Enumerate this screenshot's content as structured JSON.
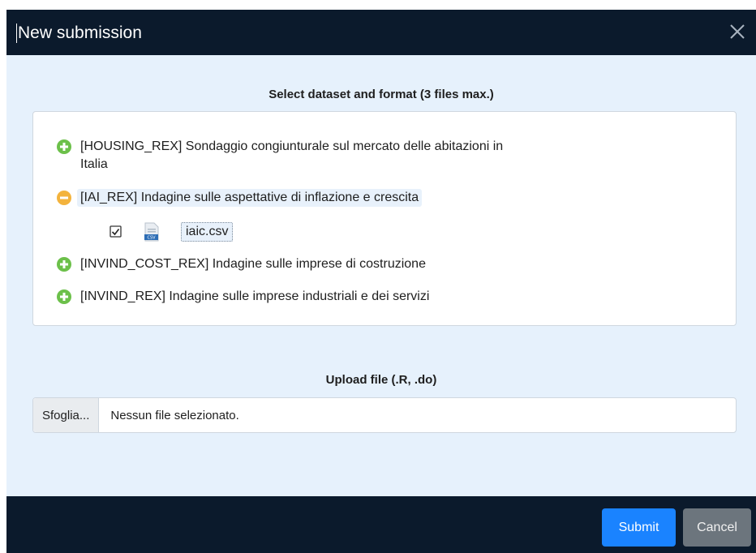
{
  "modal": {
    "title": "New submission",
    "close_icon": "close-icon"
  },
  "datasets": {
    "title": "Select dataset and format (3 files max.)",
    "items": [
      {
        "code_label": "[HOUSING_REX] Sondaggio congiunturale sul mercato delle abitazioni in",
        "label_line2": "Italia",
        "state": "collapsed",
        "icon": "plus-circle-icon"
      },
      {
        "code_label": "[IAI_REX] Indagine sulle aspettative di inflazione e crescita",
        "state": "expanded",
        "icon": "minus-circle-icon",
        "files": [
          {
            "name": "iaic.csv",
            "checked": true,
            "icon": "csv-file-icon"
          }
        ]
      },
      {
        "code_label": "[INVIND_COST_REX] Indagine sulle imprese di costruzione",
        "state": "collapsed",
        "icon": "plus-circle-icon"
      },
      {
        "code_label": "[INVIND_REX] Indagine sulle imprese industriali e dei servizi",
        "state": "collapsed",
        "icon": "plus-circle-icon"
      }
    ]
  },
  "upload": {
    "title": "Upload file (.R, .do)",
    "browse_label": "Sfoglia...",
    "status_text": "Nessun file selezionato."
  },
  "footer": {
    "submit_label": "Submit",
    "cancel_label": "Cancel"
  },
  "colors": {
    "header_bg": "#0b1a2c",
    "body_bg": "#e6f1fc",
    "plus_green": "#6cc04a",
    "minus_yellow": "#f3b33d",
    "submit_blue": "#1a83ff",
    "cancel_gray": "#6c757d"
  }
}
